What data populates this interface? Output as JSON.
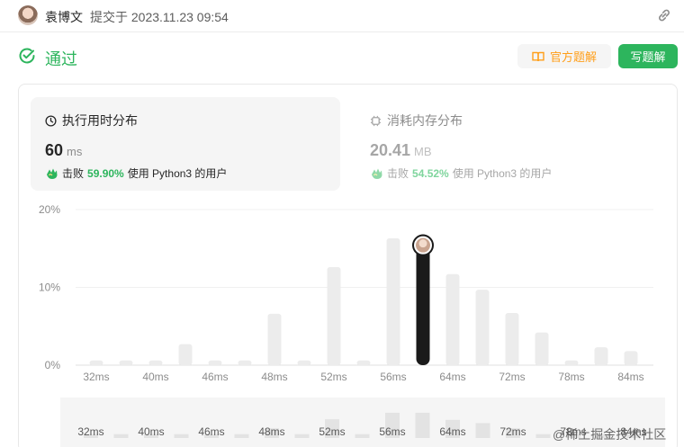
{
  "header": {
    "author": "袁博文",
    "submit_info": "提交于 2023.11.23 09:54"
  },
  "status": {
    "label": "通过",
    "color": "#2db55d"
  },
  "buttons": {
    "official_solution": "官方题解",
    "write_solution": "写题解"
  },
  "runtime": {
    "title": "执行用时分布",
    "value": "60",
    "unit": "ms",
    "beat_label": "击败",
    "beat_pct": "59.90%",
    "suffix": "使用 Python3 的用户"
  },
  "memory": {
    "title": "消耗内存分布",
    "value": "20.41",
    "unit": "MB",
    "beat_label": "击败",
    "beat_pct": "54.52%",
    "suffix": "使用 Python3 的用户"
  },
  "chart_data": {
    "type": "bar",
    "ylabel": "",
    "xlabel": "",
    "ylim": [
      0,
      20
    ],
    "yticks": [
      "0%",
      "10%",
      "20%"
    ],
    "xticks": [
      "32ms",
      "40ms",
      "46ms",
      "48ms",
      "52ms",
      "56ms",
      "64ms",
      "72ms",
      "78ms",
      "84ms"
    ],
    "values": [
      0.6,
      0.6,
      0.6,
      2.7,
      0.6,
      0.6,
      6.6,
      0.6,
      12.6,
      0.6,
      16.3,
      16.8,
      11.7,
      9.7,
      6.7,
      4.2,
      0.6,
      2.3,
      1.8
    ],
    "highlight_index": 11,
    "bar_color": "#ececec",
    "highlight_color": "#1a1a1a",
    "overview": {
      "values": [
        0.6,
        0.6,
        0.6,
        0.6,
        0.6,
        0.6,
        1.5,
        0.6,
        2.9,
        0.6,
        3.9,
        3.9,
        2.8,
        2.3,
        1.5,
        0.6,
        0.6,
        0.6,
        0.6
      ],
      "xticks": [
        "32ms",
        "40ms",
        "46ms",
        "48ms",
        "52ms",
        "56ms",
        "64ms",
        "72ms",
        "78ms",
        "84ms"
      ]
    }
  },
  "watermark": "@稀土掘金技术社区"
}
